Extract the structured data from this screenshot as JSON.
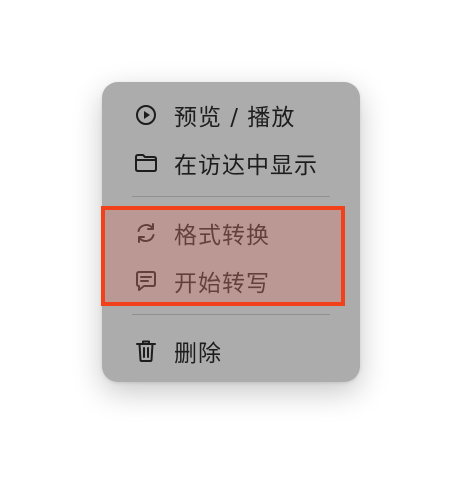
{
  "context_menu": {
    "items": [
      {
        "label": "预览 / 播放",
        "icon": "play-circle-icon"
      },
      {
        "label": "在访达中显示",
        "icon": "folder-icon"
      },
      {
        "label": "格式转换",
        "icon": "refresh-icon"
      },
      {
        "label": "开始转写",
        "icon": "message-icon"
      },
      {
        "label": "删除",
        "icon": "trash-icon"
      }
    ]
  },
  "highlight": {
    "border_color": "#f2401a",
    "covers": [
      "格式转换",
      "开始转写"
    ]
  }
}
